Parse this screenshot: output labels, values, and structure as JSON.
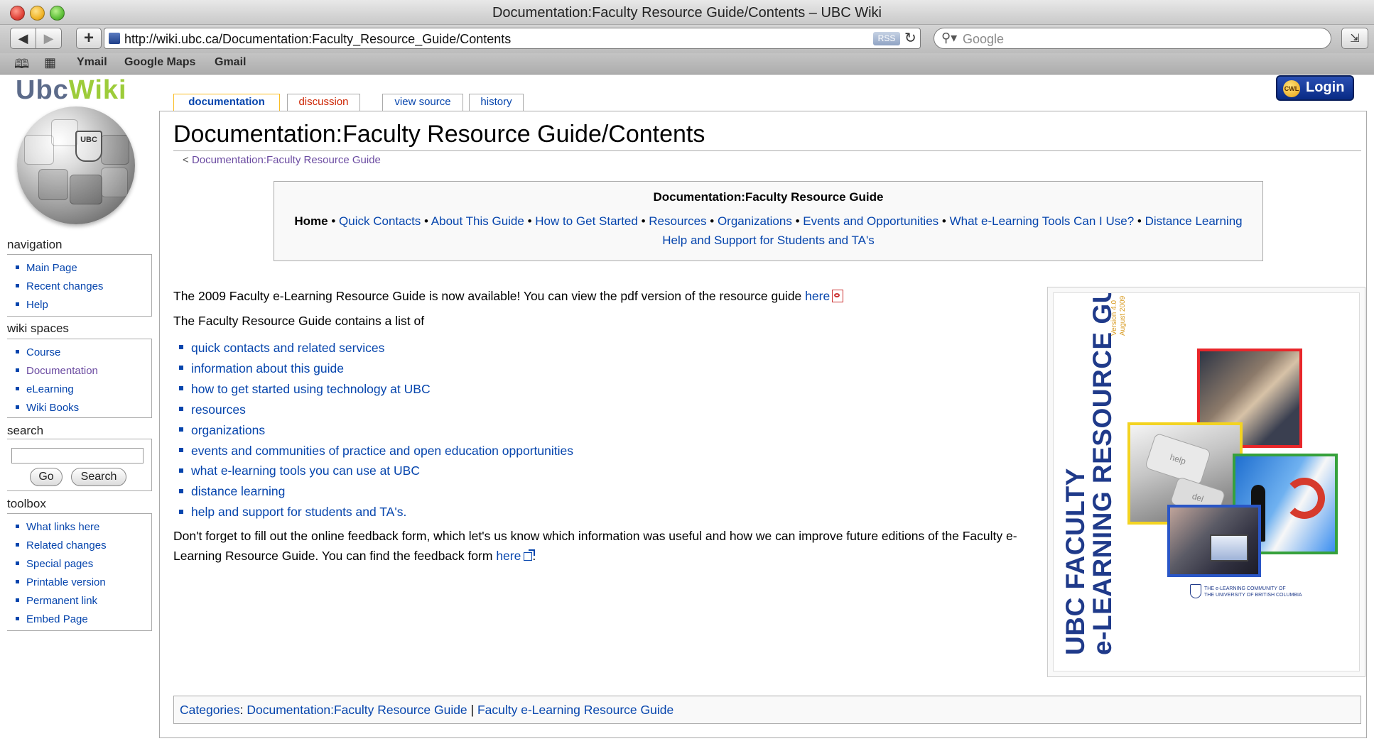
{
  "window": {
    "title": "Documentation:Faculty Resource Guide/Contents – UBC Wiki"
  },
  "browser": {
    "back_icon": "back-arrow-icon",
    "forward_icon": "forward-arrow-icon",
    "add_icon": "plus-icon",
    "url": "http://wiki.ubc.ca/Documentation:Faculty_Resource_Guide/Contents",
    "rss_label": "RSS",
    "reload_icon": "reload-icon",
    "search_placeholder": "Google",
    "bookmarks": [
      "Ymail",
      "Google Maps",
      "Gmail"
    ]
  },
  "logo": {
    "ubc": "Ubc",
    "wiki": "Wiki"
  },
  "globe": {
    "crest_text": "UBC"
  },
  "tabs": [
    {
      "label": "documentation"
    },
    {
      "label": "discussion"
    },
    {
      "label": "view source"
    },
    {
      "label": "history"
    }
  ],
  "login": {
    "badge": "CWL",
    "label": "Login"
  },
  "sidebar": {
    "navigation": {
      "heading": "navigation",
      "items": [
        "Main Page",
        "Recent changes",
        "Help"
      ]
    },
    "wiki_spaces": {
      "heading": "wiki spaces",
      "items": [
        "Course",
        "Documentation",
        "eLearning",
        "Wiki Books"
      ]
    },
    "search": {
      "heading": "search",
      "go_label": "Go",
      "search_label": "Search",
      "value": ""
    },
    "toolbox": {
      "heading": "toolbox",
      "items": [
        "What links here",
        "Related changes",
        "Special pages",
        "Printable version",
        "Permanent link",
        "Embed Page"
      ]
    }
  },
  "page": {
    "title": "Documentation:Faculty Resource Guide/Contents",
    "subpage_prefix": "< ",
    "subpage_link": "Documentation:Faculty Resource Guide",
    "navbox": {
      "title": "Documentation:Faculty Resource Guide",
      "current": "Home",
      "links": [
        "Quick Contacts",
        "About This Guide",
        "How to Get Started",
        "Resources",
        "Organizations",
        "Events and Opportunities",
        "What e-Learning Tools Can I Use?",
        "Distance Learning"
      ],
      "links_line2": [
        "Help and Support for Students and TA's"
      ]
    },
    "intro1_text": "The 2009 Faculty e-Learning Resource Guide is now available! You can view the pdf version of the resource guide ",
    "intro1_link": "here",
    "intro2": "The Faculty Resource Guide contains a list of",
    "list": [
      "quick contacts and related services",
      "information about this guide",
      "how to get started using technology at UBC",
      "resources",
      "organizations",
      "events and communities of practice and open education opportunities",
      "what e-learning tools you can use at UBC",
      "distance learning",
      "help and support for students and TA's."
    ],
    "outro_text": "Don't forget to fill out the online feedback form, which let's us know which information was useful and how we can improve future editions of the Faculty e-Learning Resource Guide. You can find the feedback form ",
    "outro_link": "here",
    "outro_end": ".",
    "cover": {
      "title_line1": "UBC FACULTY",
      "title_line2": "e-LEARNING RESOURCE GUIDE",
      "version_line1": "Version 4.0",
      "version_line2": "August 2009",
      "key_help": "help",
      "key_del": "del",
      "footer_line1": "THE e-LEARNING COMMUNITY OF",
      "footer_line2": "THE UNIVERSITY OF BRITISH COLUMBIA",
      "accent_colors": [
        "#e8262a",
        "#f3d321",
        "#36a13c",
        "#2a56c6"
      ]
    },
    "categories": {
      "label": "Categories",
      "items": [
        "Documentation:Faculty Resource Guide",
        "Faculty e-Learning Resource Guide"
      ]
    }
  }
}
